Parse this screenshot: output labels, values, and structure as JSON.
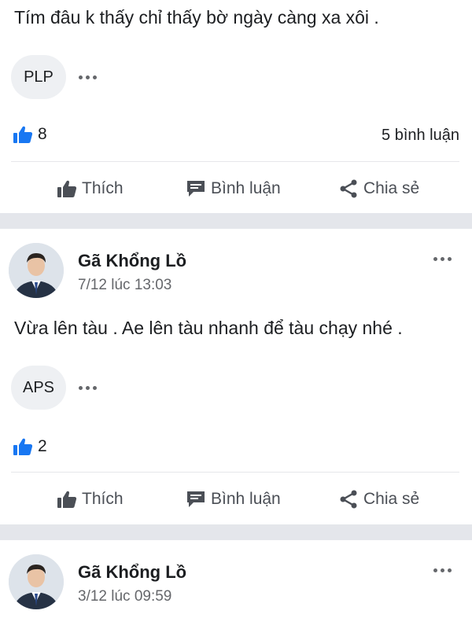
{
  "posts": [
    {
      "text": "Tím đâu k thấy chỉ thấy bờ ngày càng xa xôi .",
      "tag": "PLP",
      "likes": "8",
      "comments": "5 bình luận",
      "actions": {
        "like": "Thích",
        "comment": "Bình luận",
        "share": "Chia sẻ"
      }
    },
    {
      "author": "Gã Khổng Lồ",
      "time": "7/12 lúc 13:03",
      "text": "Vừa lên tàu . Ae lên tàu nhanh để tàu chạy nhé .",
      "tag": "APS",
      "likes": "2",
      "actions": {
        "like": "Thích",
        "comment": "Bình luận",
        "share": "Chia sẻ"
      }
    },
    {
      "author": "Gã Khổng Lồ",
      "time": "3/12 lúc 09:59"
    }
  ],
  "icons": {
    "like": "thumbs-up-icon",
    "comment": "comment-icon",
    "share": "share-icon",
    "more": "more-options-icon"
  },
  "colors": {
    "like_blue": "#1877f2",
    "text": "#1c1e21",
    "muted": "#65676b",
    "separator": "#e4e6eb"
  }
}
